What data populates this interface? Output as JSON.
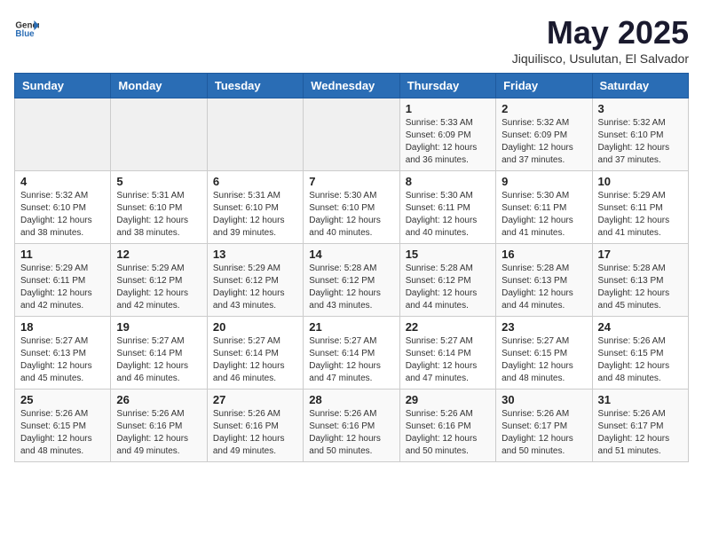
{
  "header": {
    "logo_general": "General",
    "logo_blue": "Blue",
    "title": "May 2025",
    "subtitle": "Jiquilisco, Usulutan, El Salvador"
  },
  "weekdays": [
    "Sunday",
    "Monday",
    "Tuesday",
    "Wednesday",
    "Thursday",
    "Friday",
    "Saturday"
  ],
  "weeks": [
    [
      {
        "day": "",
        "info": ""
      },
      {
        "day": "",
        "info": ""
      },
      {
        "day": "",
        "info": ""
      },
      {
        "day": "",
        "info": ""
      },
      {
        "day": "1",
        "info": "Sunrise: 5:33 AM\nSunset: 6:09 PM\nDaylight: 12 hours\nand 36 minutes."
      },
      {
        "day": "2",
        "info": "Sunrise: 5:32 AM\nSunset: 6:09 PM\nDaylight: 12 hours\nand 37 minutes."
      },
      {
        "day": "3",
        "info": "Sunrise: 5:32 AM\nSunset: 6:10 PM\nDaylight: 12 hours\nand 37 minutes."
      }
    ],
    [
      {
        "day": "4",
        "info": "Sunrise: 5:32 AM\nSunset: 6:10 PM\nDaylight: 12 hours\nand 38 minutes."
      },
      {
        "day": "5",
        "info": "Sunrise: 5:31 AM\nSunset: 6:10 PM\nDaylight: 12 hours\nand 38 minutes."
      },
      {
        "day": "6",
        "info": "Sunrise: 5:31 AM\nSunset: 6:10 PM\nDaylight: 12 hours\nand 39 minutes."
      },
      {
        "day": "7",
        "info": "Sunrise: 5:30 AM\nSunset: 6:10 PM\nDaylight: 12 hours\nand 40 minutes."
      },
      {
        "day": "8",
        "info": "Sunrise: 5:30 AM\nSunset: 6:11 PM\nDaylight: 12 hours\nand 40 minutes."
      },
      {
        "day": "9",
        "info": "Sunrise: 5:30 AM\nSunset: 6:11 PM\nDaylight: 12 hours\nand 41 minutes."
      },
      {
        "day": "10",
        "info": "Sunrise: 5:29 AM\nSunset: 6:11 PM\nDaylight: 12 hours\nand 41 minutes."
      }
    ],
    [
      {
        "day": "11",
        "info": "Sunrise: 5:29 AM\nSunset: 6:11 PM\nDaylight: 12 hours\nand 42 minutes."
      },
      {
        "day": "12",
        "info": "Sunrise: 5:29 AM\nSunset: 6:12 PM\nDaylight: 12 hours\nand 42 minutes."
      },
      {
        "day": "13",
        "info": "Sunrise: 5:29 AM\nSunset: 6:12 PM\nDaylight: 12 hours\nand 43 minutes."
      },
      {
        "day": "14",
        "info": "Sunrise: 5:28 AM\nSunset: 6:12 PM\nDaylight: 12 hours\nand 43 minutes."
      },
      {
        "day": "15",
        "info": "Sunrise: 5:28 AM\nSunset: 6:12 PM\nDaylight: 12 hours\nand 44 minutes."
      },
      {
        "day": "16",
        "info": "Sunrise: 5:28 AM\nSunset: 6:13 PM\nDaylight: 12 hours\nand 44 minutes."
      },
      {
        "day": "17",
        "info": "Sunrise: 5:28 AM\nSunset: 6:13 PM\nDaylight: 12 hours\nand 45 minutes."
      }
    ],
    [
      {
        "day": "18",
        "info": "Sunrise: 5:27 AM\nSunset: 6:13 PM\nDaylight: 12 hours\nand 45 minutes."
      },
      {
        "day": "19",
        "info": "Sunrise: 5:27 AM\nSunset: 6:14 PM\nDaylight: 12 hours\nand 46 minutes."
      },
      {
        "day": "20",
        "info": "Sunrise: 5:27 AM\nSunset: 6:14 PM\nDaylight: 12 hours\nand 46 minutes."
      },
      {
        "day": "21",
        "info": "Sunrise: 5:27 AM\nSunset: 6:14 PM\nDaylight: 12 hours\nand 47 minutes."
      },
      {
        "day": "22",
        "info": "Sunrise: 5:27 AM\nSunset: 6:14 PM\nDaylight: 12 hours\nand 47 minutes."
      },
      {
        "day": "23",
        "info": "Sunrise: 5:27 AM\nSunset: 6:15 PM\nDaylight: 12 hours\nand 48 minutes."
      },
      {
        "day": "24",
        "info": "Sunrise: 5:26 AM\nSunset: 6:15 PM\nDaylight: 12 hours\nand 48 minutes."
      }
    ],
    [
      {
        "day": "25",
        "info": "Sunrise: 5:26 AM\nSunset: 6:15 PM\nDaylight: 12 hours\nand 48 minutes."
      },
      {
        "day": "26",
        "info": "Sunrise: 5:26 AM\nSunset: 6:16 PM\nDaylight: 12 hours\nand 49 minutes."
      },
      {
        "day": "27",
        "info": "Sunrise: 5:26 AM\nSunset: 6:16 PM\nDaylight: 12 hours\nand 49 minutes."
      },
      {
        "day": "28",
        "info": "Sunrise: 5:26 AM\nSunset: 6:16 PM\nDaylight: 12 hours\nand 50 minutes."
      },
      {
        "day": "29",
        "info": "Sunrise: 5:26 AM\nSunset: 6:16 PM\nDaylight: 12 hours\nand 50 minutes."
      },
      {
        "day": "30",
        "info": "Sunrise: 5:26 AM\nSunset: 6:17 PM\nDaylight: 12 hours\nand 50 minutes."
      },
      {
        "day": "31",
        "info": "Sunrise: 5:26 AM\nSunset: 6:17 PM\nDaylight: 12 hours\nand 51 minutes."
      }
    ]
  ]
}
